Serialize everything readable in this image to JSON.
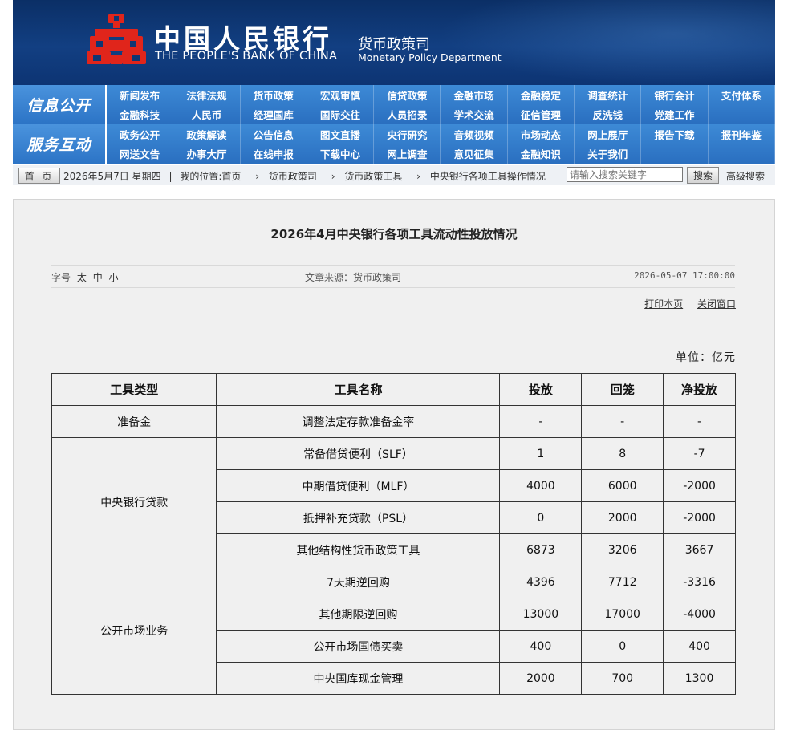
{
  "header": {
    "bank_name_cn": "中国人民银行",
    "bank_name_en": "THE PEOPLE'S BANK OF CHINA",
    "dept_cn": "货币政策司",
    "dept_en": "Monetary Policy Department",
    "logo_icon": "pboc-logo-icon"
  },
  "nav": {
    "info_label": "信息公开",
    "info_items": [
      "新闻发布",
      "法律法规",
      "货币政策",
      "宏观审慎",
      "信贷政策",
      "金融市场",
      "金融稳定",
      "调查统计",
      "银行会计",
      "支付体系",
      "金融科技",
      "人民币",
      "经理国库",
      "国际交往",
      "人员招录",
      "学术交流",
      "征信管理",
      "反洗钱",
      "党建工作",
      ""
    ],
    "service_label": "服务互动",
    "service_items": [
      "政务公开",
      "政策解读",
      "公告信息",
      "图文直播",
      "央行研究",
      "音频视频",
      "市场动态",
      "网上展厅",
      "报告下载",
      "报刊年鉴",
      "网送文告",
      "办事大厅",
      "在线申报",
      "下载中心",
      "网上调查",
      "意见征集",
      "金融知识",
      "关于我们",
      "",
      ""
    ]
  },
  "crumbbar": {
    "home_label": "首 页",
    "date": "2026年5月7日 星期四",
    "separator": "|",
    "location_label": "我的位置:首页",
    "crumbs": [
      "货币政策司",
      "货币政策工具",
      "中央银行各项工具操作情况"
    ],
    "arrow": "›",
    "search_placeholder": "请输入搜索关键字",
    "search_button": "搜索",
    "advanced_search": "高级搜索"
  },
  "article": {
    "title": "2026年4月中央银行各项工具流动性投放情况",
    "font_size_label": "字号",
    "font_sizes": [
      "太",
      "中",
      "小"
    ],
    "source": "文章来源：货币政策司",
    "published": "2026-05-07 17:00:00",
    "print_label": "打印本页",
    "close_label": "关闭窗口",
    "unit": "单位：亿元"
  },
  "table": {
    "headers": [
      "工具类型",
      "工具名称",
      "投放",
      "回笼",
      "净投放"
    ],
    "groups": [
      {
        "type": "准备金",
        "rows": [
          [
            "调整法定存款准备金率",
            "-",
            "-",
            "-"
          ]
        ]
      },
      {
        "type": "中央银行贷款",
        "rows": [
          [
            "常备借贷便利（SLF）",
            "1",
            "8",
            "-7"
          ],
          [
            "中期借贷便利（MLF）",
            "4000",
            "6000",
            "-2000"
          ],
          [
            "抵押补充贷款（PSL）",
            "0",
            "2000",
            "-2000"
          ],
          [
            "其他结构性货币政策工具",
            "6873",
            "3206",
            "3667"
          ]
        ]
      },
      {
        "type": "公开市场业务",
        "rows": [
          [
            "7天期逆回购",
            "4396",
            "7712",
            "-3316"
          ],
          [
            "其他期限逆回购",
            "13000",
            "17000",
            "-4000"
          ],
          [
            "公开市场国债买卖",
            "400",
            "0",
            "400"
          ],
          [
            "中央国库现金管理",
            "2000",
            "700",
            "1300"
          ]
        ]
      }
    ]
  }
}
